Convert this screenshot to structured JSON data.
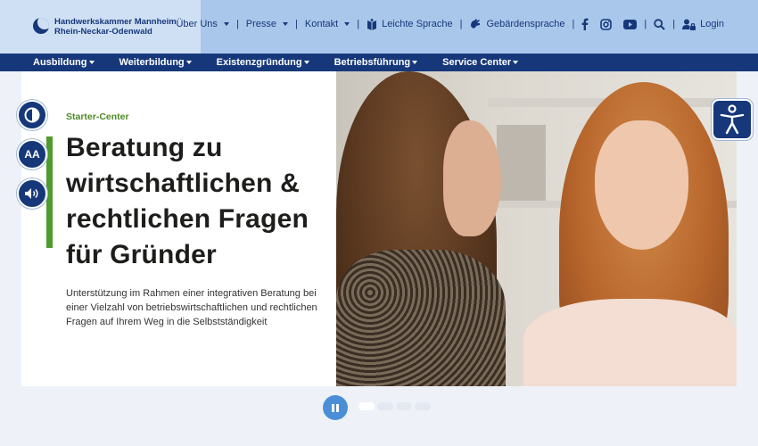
{
  "header": {
    "logo_line1": "Handwerkskammer Mannheim",
    "logo_line2": "Rhein-Neckar-Odenwald",
    "top_links": [
      {
        "label": "Über Uns",
        "dropdown": true
      },
      {
        "label": "Presse",
        "dropdown": true
      },
      {
        "label": "Kontakt",
        "dropdown": true
      }
    ],
    "easy_language": "Leichte Sprache",
    "sign_language": "Gebärdensprache",
    "login": "Login",
    "icons": [
      "book-icon",
      "sign-language-icon",
      "facebook-icon",
      "instagram-icon",
      "youtube-icon",
      "search-icon",
      "user-lock-icon"
    ]
  },
  "main_nav": [
    {
      "label": "Ausbildung"
    },
    {
      "label": "Weiterbildung"
    },
    {
      "label": "Existenzgründung"
    },
    {
      "label": "Betriebsführung"
    },
    {
      "label": "Service Center"
    }
  ],
  "hero": {
    "kicker": "Starter-Center",
    "headline": "Beratung zu wirtschaftlichen & rechtlichen Fragen für Gründer",
    "subtext": "Unterstützung im Rahmen einer integrativen Beratung bei einer Vielzahl von betriebswirtschaftlichen und rechtlichen Fragen auf Ihrem Weg in die Selbstständigkeit"
  },
  "a11y": {
    "contrast_icon": "contrast-icon",
    "font_size_label": "AA",
    "audio_icon": "speaker-icon",
    "accessibility_icon": "accessibility-icon"
  },
  "slider": {
    "slide_count": 4,
    "active_index": 0
  },
  "colors": {
    "navy": "#16387a",
    "top_bar": "#a9c7ea",
    "accent_green": "#4e9a2a",
    "pause_blue": "#4a8fd6"
  }
}
